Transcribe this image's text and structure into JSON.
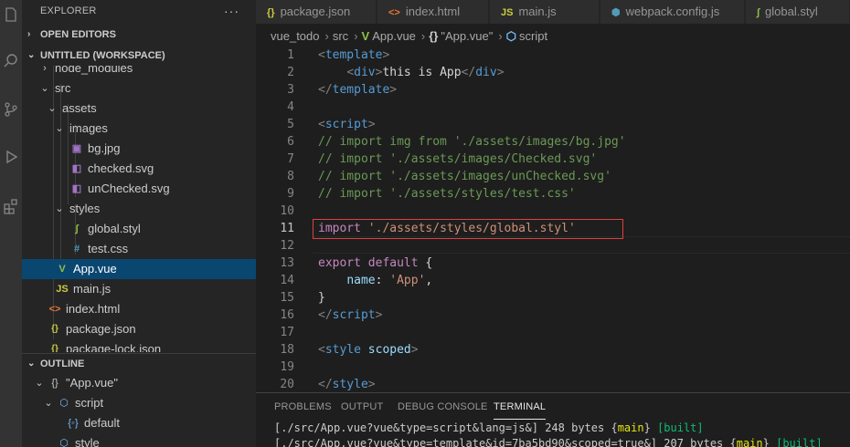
{
  "activity_bar": {
    "icons": [
      "files-icon",
      "search-icon",
      "source-control-icon",
      "run-debug-icon",
      "extensions-icon"
    ]
  },
  "sidebar": {
    "title": "EXPLORER",
    "more_actions": "···",
    "open_editors": "OPEN EDITORS",
    "workspace": "UNTITLED (WORKSPACE)",
    "tree": [
      {
        "label": "node_modules",
        "icon": "",
        "twistie": "›"
      },
      {
        "label": "src",
        "icon": "",
        "twistie": "⌄"
      },
      {
        "label": "assets",
        "icon": "",
        "twistie": "⌄"
      },
      {
        "label": "images",
        "icon": "",
        "twistie": "⌄"
      },
      {
        "label": "bg.jpg",
        "icon": "▣",
        "twistie": ""
      },
      {
        "label": "checked.svg",
        "icon": "◧",
        "twistie": ""
      },
      {
        "label": "unChecked.svg",
        "icon": "◧",
        "twistie": ""
      },
      {
        "label": "styles",
        "icon": "",
        "twistie": "⌄"
      },
      {
        "label": "global.styl",
        "icon": "∫",
        "twistie": ""
      },
      {
        "label": "test.css",
        "icon": "#",
        "twistie": ""
      },
      {
        "label": "App.vue",
        "icon": "V",
        "twistie": ""
      },
      {
        "label": "main.js",
        "icon": "JS",
        "twistie": ""
      },
      {
        "label": "index.html",
        "icon": "<>",
        "twistie": ""
      },
      {
        "label": "package.json",
        "icon": "{}",
        "twistie": ""
      },
      {
        "label": "package-lock.json",
        "icon": "{}",
        "twistie": ""
      }
    ],
    "outline": "OUTLINE",
    "outline_tree": [
      {
        "label": "\"App.vue\"",
        "icon": "{}",
        "twistie": "⌄"
      },
      {
        "label": "script",
        "icon": "⬡",
        "twistie": "⌄"
      },
      {
        "label": "default",
        "icon": "{◦}",
        "twistie": ""
      },
      {
        "label": "style",
        "icon": "⬡",
        "twistie": ""
      }
    ]
  },
  "tabs": [
    {
      "label": "package.json",
      "icon": "{}"
    },
    {
      "label": "index.html",
      "icon": "<>"
    },
    {
      "label": "main.js",
      "icon": "JS"
    },
    {
      "label": "webpack.config.js",
      "icon": "⬢"
    },
    {
      "label": "global.styl",
      "icon": "∫"
    }
  ],
  "breadcrumb": {
    "parts": [
      "vue_todo",
      "src",
      "App.vue",
      "\"App.vue\"",
      "script"
    ],
    "icons": [
      "",
      "",
      "V",
      "{}",
      "⬡"
    ]
  },
  "editor": {
    "lines": [
      {
        "n": "1",
        "tokens": [
          [
            "tk-punc",
            "<"
          ],
          [
            "tk-tag",
            "template"
          ],
          [
            "tk-punc",
            ">"
          ]
        ]
      },
      {
        "n": "2",
        "tokens": [
          [
            "tk-text",
            "    "
          ],
          [
            "tk-punc",
            "<"
          ],
          [
            "tk-tag",
            "div"
          ],
          [
            "tk-punc",
            ">"
          ],
          [
            "tk-text",
            "this is App"
          ],
          [
            "tk-punc",
            "</"
          ],
          [
            "tk-tag",
            "div"
          ],
          [
            "tk-punc",
            ">"
          ]
        ]
      },
      {
        "n": "3",
        "tokens": [
          [
            "tk-punc",
            "</"
          ],
          [
            "tk-tag",
            "template"
          ],
          [
            "tk-punc",
            ">"
          ]
        ]
      },
      {
        "n": "4",
        "tokens": []
      },
      {
        "n": "5",
        "tokens": [
          [
            "tk-punc",
            "<"
          ],
          [
            "tk-tag",
            "script"
          ],
          [
            "tk-punc",
            ">"
          ]
        ]
      },
      {
        "n": "6",
        "tokens": [
          [
            "tk-cmt",
            "// import img from './assets/images/bg.jpg'"
          ]
        ]
      },
      {
        "n": "7",
        "tokens": [
          [
            "tk-cmt",
            "// import './assets/images/Checked.svg'"
          ]
        ]
      },
      {
        "n": "8",
        "tokens": [
          [
            "tk-cmt",
            "// import './assets/images/unChecked.svg'"
          ]
        ]
      },
      {
        "n": "9",
        "tokens": [
          [
            "tk-cmt",
            "// import './assets/styles/test.css'"
          ]
        ]
      },
      {
        "n": "10",
        "tokens": []
      },
      {
        "n": "11",
        "tokens": [
          [
            "tk-kw",
            "import"
          ],
          [
            "tk-text",
            " "
          ],
          [
            "tk-str",
            "'./assets/styles/global.styl'"
          ]
        ]
      },
      {
        "n": "12",
        "tokens": []
      },
      {
        "n": "13",
        "tokens": [
          [
            "tk-kw",
            "export"
          ],
          [
            "tk-text",
            " "
          ],
          [
            "tk-kw",
            "default"
          ],
          [
            "tk-text",
            " {"
          ]
        ]
      },
      {
        "n": "14",
        "tokens": [
          [
            "tk-text",
            "    "
          ],
          [
            "tk-attr",
            "name"
          ],
          [
            "tk-text",
            ": "
          ],
          [
            "tk-str",
            "'App'"
          ],
          [
            "tk-text",
            ","
          ]
        ]
      },
      {
        "n": "15",
        "tokens": [
          [
            "tk-text",
            "}"
          ]
        ]
      },
      {
        "n": "16",
        "tokens": [
          [
            "tk-punc",
            "</"
          ],
          [
            "tk-tag",
            "script"
          ],
          [
            "tk-punc",
            ">"
          ]
        ]
      },
      {
        "n": "17",
        "tokens": []
      },
      {
        "n": "18",
        "tokens": [
          [
            "tk-punc",
            "<"
          ],
          [
            "tk-tag",
            "style"
          ],
          [
            "tk-text",
            " "
          ],
          [
            "tk-attr",
            "scoped"
          ],
          [
            "tk-punc",
            ">"
          ]
        ]
      },
      {
        "n": "19",
        "tokens": []
      },
      {
        "n": "20",
        "tokens": [
          [
            "tk-punc",
            "</"
          ],
          [
            "tk-tag",
            "style"
          ],
          [
            "tk-punc",
            ">"
          ]
        ]
      }
    ]
  },
  "panel": {
    "tabs": [
      "PROBLEMS",
      "OUTPUT",
      "DEBUG CONSOLE",
      "TERMINAL"
    ],
    "terminal_lines": [
      [
        [
          "",
          "[./src/App.vue?vue&type=script&lang=js&] 248 bytes "
        ],
        [
          "",
          "{"
        ],
        [
          "t-yel",
          "main"
        ],
        [
          "",
          "} "
        ],
        [
          "t-grn",
          "[built]"
        ]
      ],
      [
        [
          "",
          "[./src/App.vue?vue&type=template&id=7ba5bd90&scoped=true&] 207 bytes "
        ],
        [
          "",
          "{"
        ],
        [
          "t-yel",
          "main"
        ],
        [
          "",
          "} "
        ],
        [
          "t-grn",
          "[built]"
        ]
      ]
    ]
  },
  "colors": {
    "accent": "#094771",
    "highlight_box": "#e04040"
  }
}
